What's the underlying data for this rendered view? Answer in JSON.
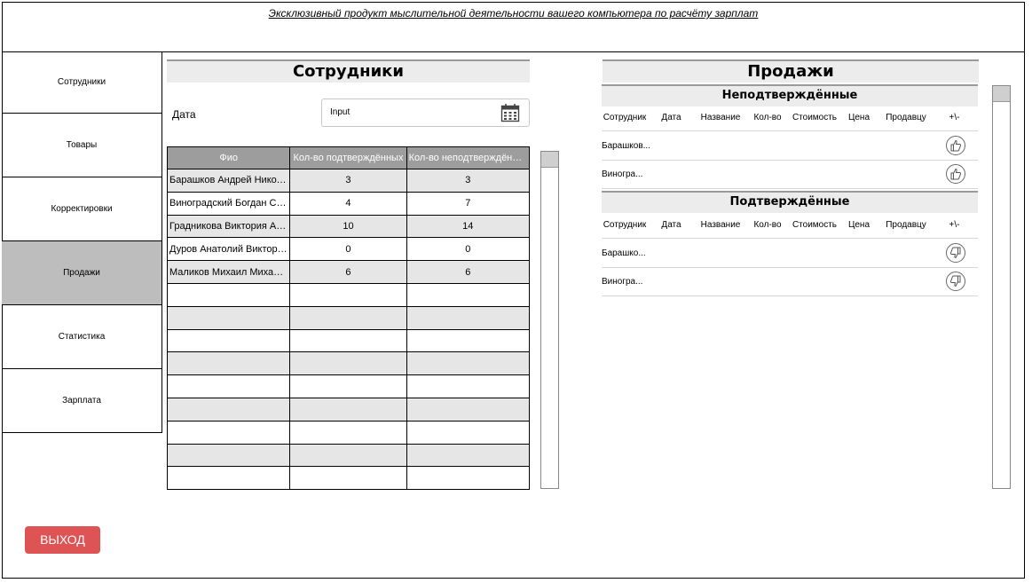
{
  "header": {
    "title": "Эксклюзивный продукт мыслительной деятельности вашего компьютера по расчёту зарплат"
  },
  "sidebar": {
    "items": [
      {
        "label": "Сотрудники"
      },
      {
        "label": "Товары"
      },
      {
        "label": "Корректировки"
      },
      {
        "label": "Продажи",
        "active": true
      },
      {
        "label": "Статистика"
      },
      {
        "label": "Зарплата"
      }
    ]
  },
  "employees": {
    "title": "Сотрудники",
    "date_label": "Дата",
    "date_input_value": "Input",
    "columns": [
      "Фио",
      "Кол-во подтверждённых",
      "Кол-во неподтверждённых"
    ],
    "rows": [
      {
        "name": "Барашков Андрей Николаевич",
        "confirmed": "3",
        "unconfirmed": "3"
      },
      {
        "name": "Виноградский Богдан Сергеевич",
        "confirmed": "4",
        "unconfirmed": "7"
      },
      {
        "name": "Градникова Виктория Андреевна",
        "confirmed": "10",
        "unconfirmed": "14"
      },
      {
        "name": "Дуров Анатолий Викторович",
        "confirmed": "0",
        "unconfirmed": "0"
      },
      {
        "name": "Маликов Михаил Михайлович",
        "confirmed": "6",
        "unconfirmed": "6"
      }
    ],
    "empty_rows": 9
  },
  "sales": {
    "title": "Продажи",
    "unconfirmed": {
      "title": "Неподтверждённые",
      "columns": [
        "Сотрудник",
        "Дата",
        "Название",
        "Кол-во",
        "Стоимость",
        "Цена",
        "Продавцу",
        "+\\-"
      ],
      "rows": [
        {
          "employee": "Барашков..."
        },
        {
          "employee": "Виногра..."
        }
      ],
      "action_icon": "thumbs-up-icon"
    },
    "confirmed": {
      "title": "Подтверждённые",
      "columns": [
        "Сотрудник",
        "Дата",
        "Название",
        "Кол-во",
        "Стоимость",
        "Цена",
        "Продавцу",
        "+\\-"
      ],
      "rows": [
        {
          "employee": "Барашко..."
        },
        {
          "employee": "Виногра..."
        }
      ],
      "action_icon": "thumbs-down-icon"
    }
  },
  "exit_button": {
    "label": "ВЫХОД"
  },
  "colors": {
    "accent": "#de5454",
    "active_nav": "#bdbdbd",
    "table_header": "#9d9d9d",
    "row_alt": "#e6e6e6"
  }
}
